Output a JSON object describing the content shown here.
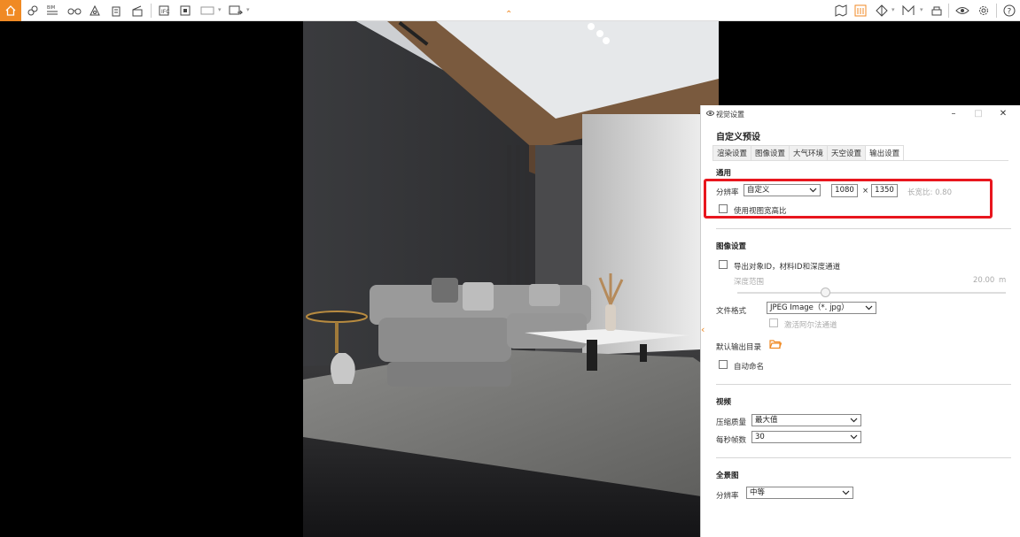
{
  "toolbar": {
    "left_icons": [
      "home-icon",
      "link-icon",
      "bim-icon",
      "binoculars-icon",
      "camera-icon",
      "building-icon",
      "clapper-icon",
      "export-icon",
      "render-icon",
      "video-icon",
      "vr-icon"
    ],
    "right_icons": [
      "map-icon",
      "library-icon",
      "cube-icon",
      "material-icon",
      "sky-icon",
      "view-icon",
      "settings-icon",
      "help-icon"
    ],
    "bim_label": "BIM"
  },
  "colors": {
    "accent": "#f08a24",
    "highlight": "#e8161e"
  },
  "panel": {
    "title": "视觉设置",
    "preset": "自定义预设",
    "tabs": [
      "渲染设置",
      "图像设置",
      "大气环境",
      "天空设置",
      "输出设置"
    ],
    "active_tab": 4,
    "general": {
      "heading": "通用",
      "resolution_label": "分辨率",
      "resolution_value": "自定义",
      "width": "1080",
      "times": "×",
      "height": "1350",
      "aspect_label": "长宽比: 0.80",
      "use_viewport_ratio": "使用视图宽高比"
    },
    "image": {
      "heading": "图像设置",
      "export_channels": "导出对象ID，材料ID和深度通道",
      "depth_range_label": "深度范围",
      "depth_range_value": "20.00",
      "depth_unit": "m",
      "depth_slider_fraction": 0.31,
      "file_format_label": "文件格式",
      "file_format_value": "JPEG Image（*. jpg）",
      "alpha_channel": "激活阿尔法通道",
      "output_dir_label": "默认输出目录",
      "auto_name": "自动命名"
    },
    "video": {
      "heading": "视频",
      "quality_label": "压缩质量",
      "quality_value": "最大值",
      "fps_label": "每秒帧数",
      "fps_value": "30"
    },
    "panorama": {
      "heading": "全景图",
      "resolution_label": "分辨率",
      "resolution_value": "中等"
    }
  }
}
